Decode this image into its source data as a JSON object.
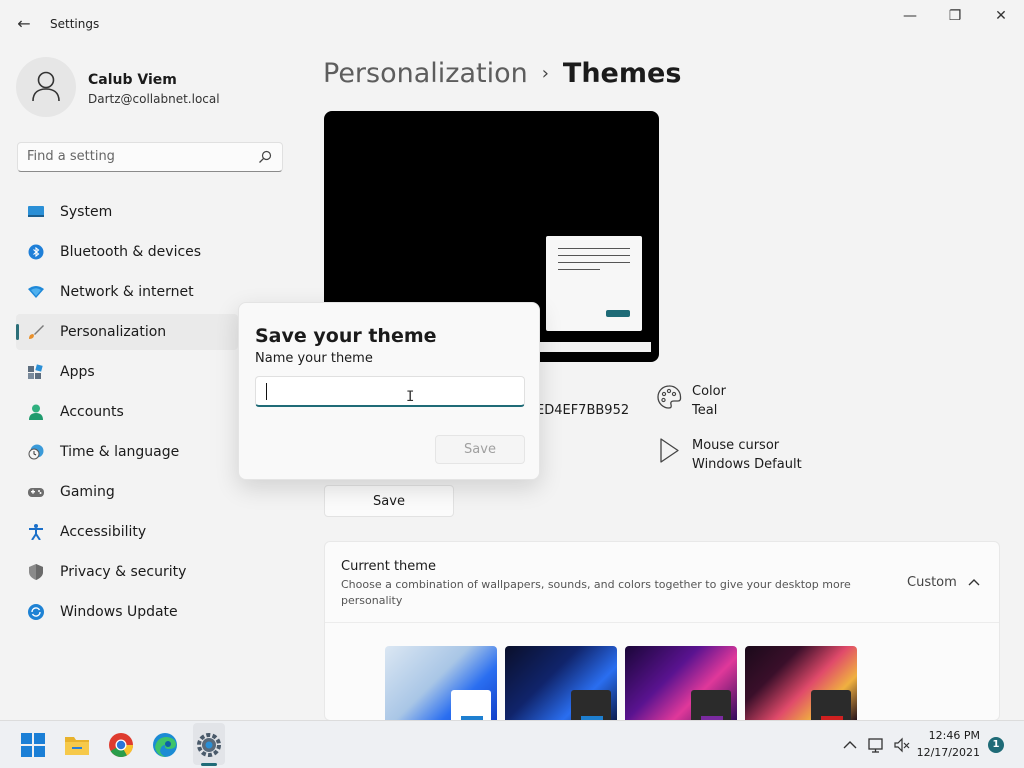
{
  "window": {
    "title": "Settings",
    "controls": {
      "minimize": "—",
      "maximize": "❐",
      "close": "✕"
    }
  },
  "user": {
    "name": "Calub Viem",
    "email": "Dartz@collabnet.local"
  },
  "search": {
    "placeholder": "Find a setting",
    "value": ""
  },
  "nav": {
    "items": [
      {
        "label": "System",
        "icon": "monitor-icon",
        "active": false
      },
      {
        "label": "Bluetooth & devices",
        "icon": "bluetooth-icon",
        "active": false
      },
      {
        "label": "Network & internet",
        "icon": "wifi-icon",
        "active": false
      },
      {
        "label": "Personalization",
        "icon": "paintbrush-icon",
        "active": true
      },
      {
        "label": "Apps",
        "icon": "apps-icon",
        "active": false
      },
      {
        "label": "Accounts",
        "icon": "person-icon",
        "active": false
      },
      {
        "label": "Time & language",
        "icon": "clock-globe-icon",
        "active": false
      },
      {
        "label": "Gaming",
        "icon": "gamepad-icon",
        "active": false
      },
      {
        "label": "Accessibility",
        "icon": "accessibility-icon",
        "active": false
      },
      {
        "label": "Privacy & security",
        "icon": "shield-icon",
        "active": false
      },
      {
        "label": "Windows Update",
        "icon": "update-icon",
        "active": false
      }
    ]
  },
  "breadcrumb": {
    "parent": "Personalization",
    "separator": "›",
    "current": "Themes"
  },
  "theme_info": {
    "background_partial": "ED4EF7BB952",
    "color": {
      "title": "Color",
      "value": "Teal"
    },
    "cursor": {
      "title": "Mouse cursor",
      "value": "Windows Default"
    }
  },
  "save_button": "Save",
  "current_theme": {
    "title": "Current theme",
    "description": "Choose a combination of wallpapers, sounds, and colors together to give your desktop more personality",
    "value": "Custom"
  },
  "dialog": {
    "title": "Save your theme",
    "label": "Name your theme",
    "input_value": "",
    "save_label": "Save"
  },
  "taskbar": {
    "apps": [
      "start-icon",
      "file-explorer-icon",
      "chrome-icon",
      "edge-icon",
      "settings-icon"
    ],
    "time": "12:46 PM",
    "date": "12/17/2021",
    "notification_count": "1"
  },
  "colors": {
    "accent": "#1f6b77",
    "background": "#f3f3f3"
  }
}
